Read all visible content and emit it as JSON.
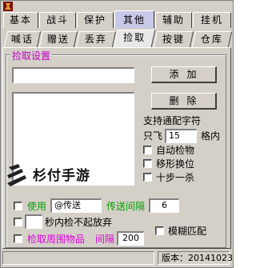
{
  "tabs_top": [
    "基本",
    "战斗",
    "保护",
    "其他",
    "辅助",
    "挂机"
  ],
  "tabs_top_active": "其他",
  "tabs_sub": [
    "喊话",
    "赠送",
    "丢弃",
    "捡取",
    "按键",
    "仓库"
  ],
  "tabs_sub_active": "捡取",
  "group": {
    "title": "捡取设置",
    "item_input_value": "",
    "add_button": "添加",
    "delete_button": "删除",
    "wildcard_label": "支持通配字符",
    "only_fly_label": "只飞",
    "only_fly_value": "15",
    "grid_within_label": "格内",
    "auto_pick_label": "自动检物",
    "move_shape_label": "移形换位",
    "ten_step_label": "十步一杀",
    "use_label": "使用",
    "teleport_value": "@传送",
    "teleport_interval_label": "传送间隔",
    "teleport_interval_value": "6",
    "seconds_label": "秒内检不起放弃",
    "seconds_value": "",
    "pick_nearby_label": "检取周围物品",
    "interval_label": "间隔",
    "interval_value": "200",
    "fuzzy_label": "模糊匹配"
  },
  "watermark": "杉付手游",
  "status": {
    "version": "版本：20141023"
  },
  "colors": {
    "accent_title": "#c000c0",
    "green": "#00a000",
    "magenta": "#e000e0",
    "active_tab": "#c8c8e8"
  }
}
